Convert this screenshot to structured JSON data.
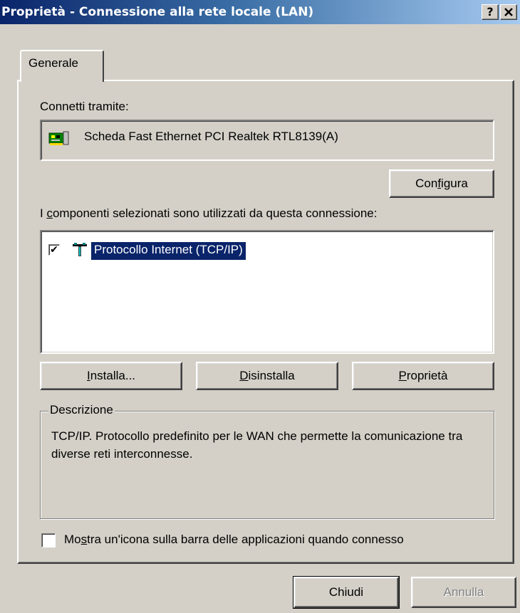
{
  "window": {
    "title": "Proprietà - Connessione alla rete locale (LAN)",
    "help_label": "?",
    "close_label": "✕"
  },
  "tabs": [
    {
      "label": "Generale",
      "selected": true
    }
  ],
  "connect_via": {
    "label": "Connetti tramite:",
    "adapter": "Scheda Fast Ethernet PCI Realtek RTL8139(A)",
    "adapter_icon": "network-card-icon"
  },
  "buttons": {
    "configure": {
      "pre": "Con",
      "key": "f",
      "post": "igura"
    },
    "install": {
      "pre": "",
      "key": "I",
      "post": "nstalla..."
    },
    "uninstall": {
      "pre": "",
      "key": "D",
      "post": "isinstalla"
    },
    "properties": {
      "pre": "",
      "key": "P",
      "post": "roprietà"
    },
    "close": "Chiudi",
    "cancel": "Annulla"
  },
  "components": {
    "label_pre": "I ",
    "label_key": "c",
    "label_post": "omponenti selezionati sono utilizzati da questa connessione:",
    "items": [
      {
        "label": "Protocollo Internet (TCP/IP)",
        "checked": true,
        "selected": true,
        "icon": "network-protocol-icon"
      }
    ]
  },
  "description": {
    "legend": "Descrizione",
    "text": "TCP/IP. Protocollo predefinito per le WAN che permette la comunicazione tra diverse reti interconnesse."
  },
  "taskbar_icon_option": {
    "label_pre": "Mo",
    "label_key": "s",
    "label_post": "tra un'icona sulla barra delle applicazioni quando connesso",
    "checked": false
  },
  "colors": {
    "face": "#d4d0c8",
    "selection": "#0a246a",
    "title_start": "#0a246a",
    "title_end": "#a6caf0"
  }
}
